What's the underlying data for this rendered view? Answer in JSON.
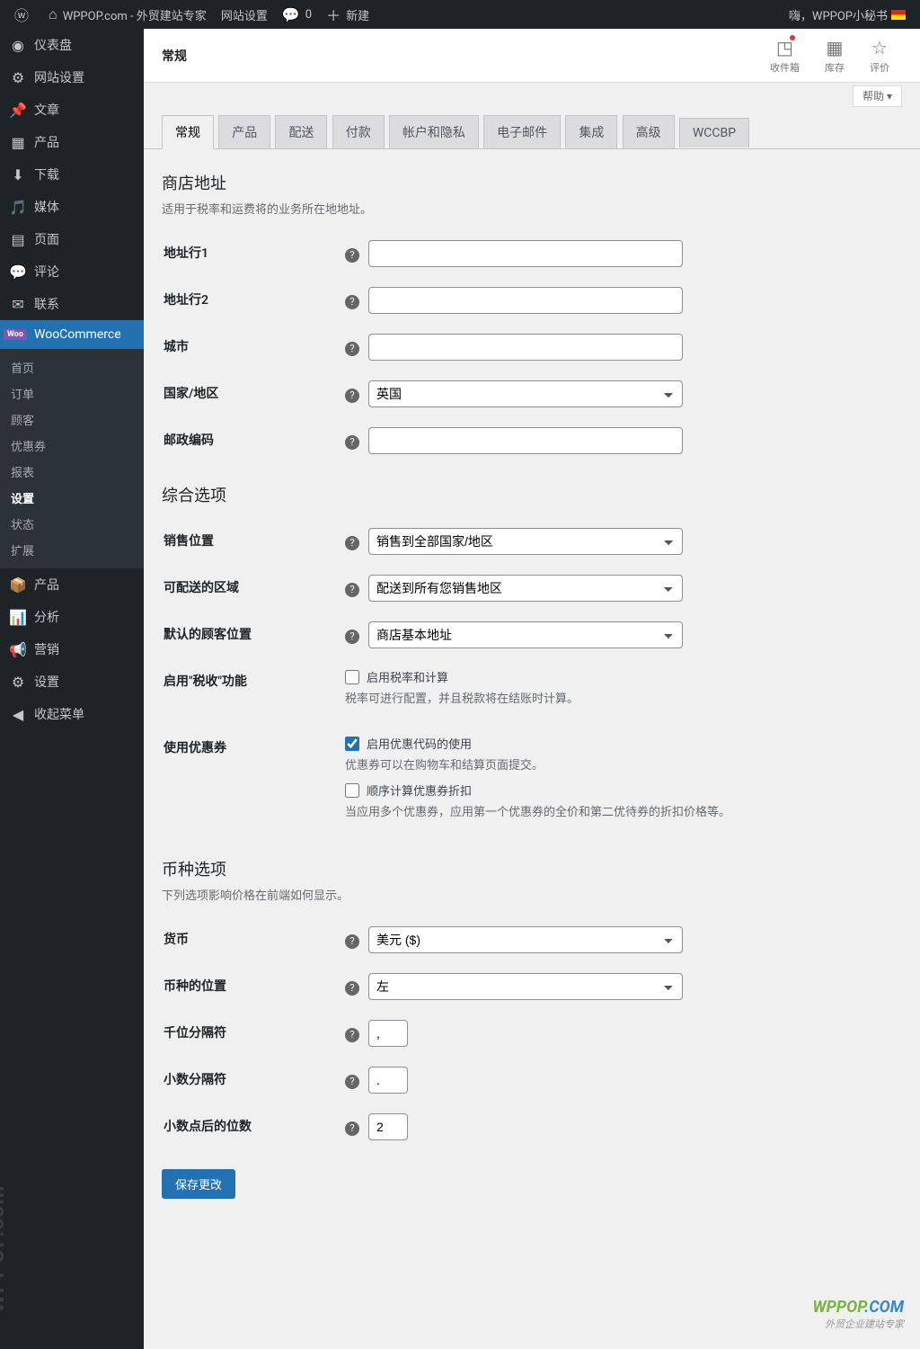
{
  "adminbar": {
    "site": "WPPOP.com - 外贸建站专家",
    "settings": "网站设置",
    "comments": "0",
    "new": "新建",
    "greeting": "嗨，WPPOP小秘书"
  },
  "sidebar": {
    "items": [
      {
        "label": "仪表盘",
        "icon": "◉"
      },
      {
        "label": "网站设置",
        "icon": "⚙"
      },
      {
        "label": "文章",
        "icon": "✎"
      },
      {
        "label": "产品",
        "icon": "▦"
      },
      {
        "label": "下载",
        "icon": "⬇"
      },
      {
        "label": "媒体",
        "icon": "🖼"
      },
      {
        "label": "页面",
        "icon": "▤"
      },
      {
        "label": "评论",
        "icon": "💬"
      },
      {
        "label": "联系",
        "icon": "✉"
      },
      {
        "label": "WooCommerce",
        "icon": "woo"
      },
      {
        "label": "产品",
        "icon": "📦"
      },
      {
        "label": "分析",
        "icon": "📊"
      },
      {
        "label": "营销",
        "icon": "📢"
      },
      {
        "label": "设置",
        "icon": "⚙"
      },
      {
        "label": "收起菜单",
        "icon": "◀"
      }
    ],
    "submenu": [
      "首页",
      "订单",
      "顾客",
      "优惠券",
      "报表",
      "设置",
      "状态",
      "扩展"
    ]
  },
  "header": {
    "title": "常规",
    "inbox": "收件箱",
    "stock": "库存",
    "reviews": "评价",
    "help": "帮助 ▾"
  },
  "tabs": [
    "常规",
    "产品",
    "配送",
    "付款",
    "帐户和隐私",
    "电子邮件",
    "集成",
    "高级",
    "WCCBP"
  ],
  "sections": {
    "address": {
      "title": "商店地址",
      "desc": "适用于税率和运费将的业务所在地地址。"
    },
    "general": {
      "title": "综合选项"
    },
    "currency": {
      "title": "币种选项",
      "desc": "下列选项影响价格在前端如何显示。"
    }
  },
  "fields": {
    "address1": {
      "label": "地址行1",
      "value": ""
    },
    "address2": {
      "label": "地址行2",
      "value": ""
    },
    "city": {
      "label": "城市",
      "value": ""
    },
    "country": {
      "label": "国家/地区",
      "value": "英国"
    },
    "postcode": {
      "label": "邮政编码",
      "value": ""
    },
    "selling": {
      "label": "销售位置",
      "value": "销售到全部国家/地区"
    },
    "shipping": {
      "label": "可配送的区域",
      "value": "配送到所有您销售地区"
    },
    "customer_loc": {
      "label": "默认的顾客位置",
      "value": "商店基本地址"
    },
    "tax": {
      "label": "启用\"税收\"功能",
      "check": "启用税率和计算",
      "desc": "税率可进行配置，并且税款将在结账时计算。"
    },
    "coupon": {
      "label": "使用优惠券",
      "check1": "启用优惠代码的使用",
      "desc1": "优惠券可以在购物车和结算页面提交。",
      "check2": "顺序计算优惠券折扣",
      "desc2": "当应用多个优惠券，应用第一个优惠券的全价和第二优待券的折扣价格等。"
    },
    "currency": {
      "label": "货币",
      "value": "美元 ($)"
    },
    "position": {
      "label": "币种的位置",
      "value": "左"
    },
    "thousand": {
      "label": "千位分隔符",
      "value": ","
    },
    "decimal": {
      "label": "小数分隔符",
      "value": "."
    },
    "decimals": {
      "label": "小数点后的位数",
      "value": "2"
    }
  },
  "submit": "保存更改",
  "watermark": {
    "brand1": "WPPOP",
    "brand2": ".COM",
    "sub": "外贸企业建站专家"
  }
}
